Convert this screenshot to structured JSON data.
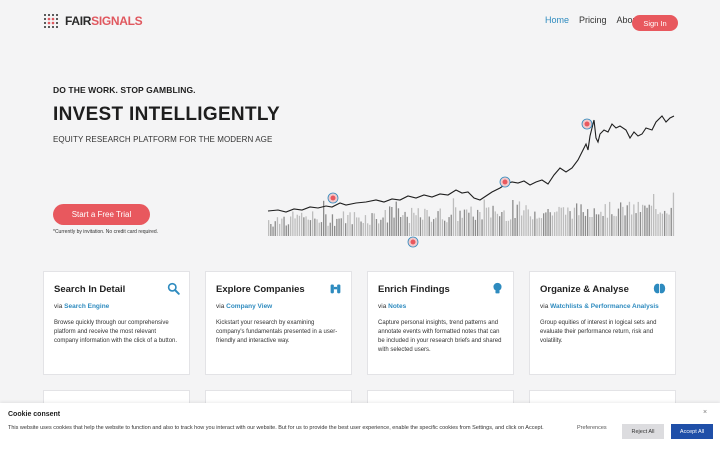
{
  "header": {
    "logo_part1": "FAIR",
    "logo_part2": "SIGNALS",
    "nav": [
      "Home",
      "Pricing",
      "About"
    ],
    "signin_label": "Sign In"
  },
  "hero": {
    "eyebrow": "DO THE WORK. STOP GAMBLING.",
    "title": "INVEST INTELLIGENTLY",
    "subtitle": "EQUITY RESEARCH PLATFORM FOR THE MODERN AGE",
    "cta_label": "Start a Free Trial",
    "cta_note": "*Currently by invitation. No credit card required."
  },
  "cards": [
    {
      "title": "Search In Detail",
      "icon": "search-icon",
      "via": "via",
      "link": "Search Engine",
      "desc": "Browse quickly through our comprehensive platform and receive the most relevant company information with the click of a button."
    },
    {
      "title": "Explore Companies",
      "icon": "binoculars-icon",
      "via": "via",
      "link": "Company View",
      "desc": "Kickstart your research by examining company's fundamentals presented in a user-friendly and interactive way."
    },
    {
      "title": "Enrich Findings",
      "icon": "lightbulb-icon",
      "via": "via",
      "link": "Notes",
      "desc": "Capture personal insights, trend patterns and annotate events with formatted notes that can be included in your research briefs and shared with selected users."
    },
    {
      "title": "Organize & Analyse",
      "icon": "brain-icon",
      "via": "via",
      "link": "Watchlists & Performance Analysis",
      "desc": "Group equities of interest in logical sets and evaluate their performance return, risk and volatility."
    }
  ],
  "cookie": {
    "title": "Cookie consent",
    "text": "This website uses cookies that help the website to function and also to track how you interact with our website. But for us to provide the best user experience, enable the specific cookies from Settings, and click on Accept.",
    "close": "×",
    "preferences": "Preferences",
    "reject": "Reject All",
    "accept": "Accept All"
  },
  "colors": {
    "accent": "#e8585e",
    "link": "#2e8bbf",
    "accept": "#1f4fa8"
  }
}
